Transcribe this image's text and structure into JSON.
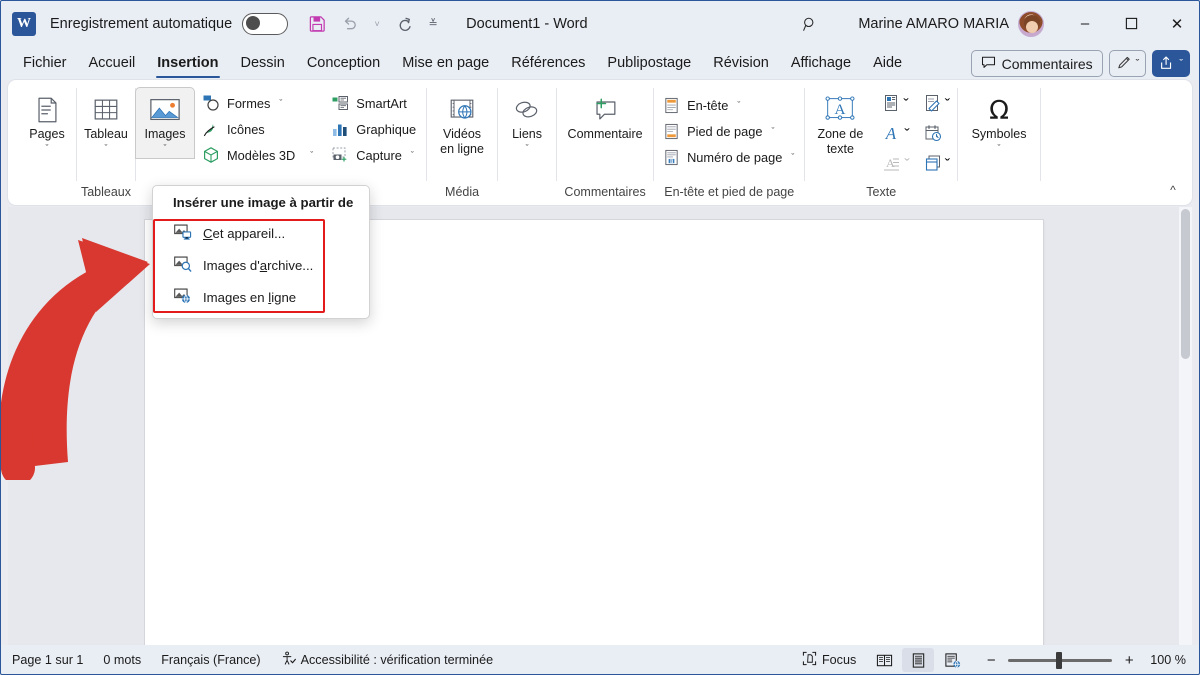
{
  "titlebar": {
    "app_logo": "word-logo",
    "autosave_label": "Enregistrement automatique",
    "autosave_state": "off",
    "save_icon": "save-icon",
    "undo_icon": "undo-icon",
    "redo_icon": "redo-icon",
    "customize_qat_icon": "customize-quick-access-toolbar-icon",
    "document_title": "Document1  -  Word",
    "search_icon": "search-icon",
    "user_name": "Marine AMARO MARIA",
    "minimize_label": "–",
    "maximize_label": "☐",
    "close_label": "✕"
  },
  "tabs": [
    {
      "label": "Fichier",
      "active": false
    },
    {
      "label": "Accueil",
      "active": false
    },
    {
      "label": "Insertion",
      "active": true
    },
    {
      "label": "Dessin",
      "active": false
    },
    {
      "label": "Conception",
      "active": false
    },
    {
      "label": "Mise en page",
      "active": false
    },
    {
      "label": "Références",
      "active": false
    },
    {
      "label": "Publipostage",
      "active": false
    },
    {
      "label": "Révision",
      "active": false
    },
    {
      "label": "Affichage",
      "active": false
    },
    {
      "label": "Aide",
      "active": false
    }
  ],
  "tabstrip_right": {
    "comments_label": "Commentaires",
    "comments_icon": "comment-icon",
    "pen_icon": "pen-icon",
    "share_icon": "share-icon",
    "chevron": "ˇ"
  },
  "ribbon": {
    "groups": [
      {
        "label": "",
        "big_buttons": [
          {
            "label": "Pages",
            "icon": "pages-icon",
            "chevron": "ˇ"
          }
        ]
      },
      {
        "label": "Tableaux",
        "big_buttons": [
          {
            "label": "Tableau",
            "icon": "table-icon",
            "chevron": "ˇ"
          }
        ]
      },
      {
        "label": "",
        "big_buttons": [
          {
            "label": "Images",
            "icon": "pictures-icon",
            "chevron": "ˇ",
            "active": true
          }
        ],
        "small_buttons": [
          {
            "label": "Formes",
            "icon": "shapes-icon",
            "chevron": "ˇ"
          },
          {
            "label": "Icônes",
            "icon": "icons-icon",
            "chevron": ""
          },
          {
            "label": "Modèles 3D",
            "icon": "3d-models-icon",
            "chevron": "ˇ"
          }
        ],
        "small_buttons2": [
          {
            "label": "SmartArt",
            "icon": "smartart-icon",
            "chevron": ""
          },
          {
            "label": "Graphique",
            "icon": "chart-icon",
            "chevron": ""
          },
          {
            "label": "Capture",
            "icon": "screenshot-icon",
            "chevron": "ˇ"
          }
        ]
      },
      {
        "label": "Média",
        "big_buttons": [
          {
            "label": "Vidéos\nen ligne",
            "icon": "online-videos-icon",
            "chevron": ""
          }
        ]
      },
      {
        "label": "",
        "big_buttons": [
          {
            "label": "Liens",
            "icon": "links-icon",
            "chevron": "ˇ"
          }
        ]
      },
      {
        "label": "Commentaires",
        "big_buttons": [
          {
            "label": "Commentaire",
            "icon": "new-comment-icon",
            "chevron": ""
          }
        ]
      },
      {
        "label": "En-tête et pied de page",
        "small_buttons": [
          {
            "label": "En-tête",
            "icon": "header-icon",
            "chevron": "ˇ"
          },
          {
            "label": "Pied de page",
            "icon": "footer-icon",
            "chevron": "ˇ"
          },
          {
            "label": "Numéro de page",
            "icon": "page-number-icon",
            "chevron": "ˇ"
          }
        ]
      },
      {
        "label": "Texte",
        "big_buttons": [
          {
            "label": "Zone de\ntexte",
            "icon": "text-box-icon",
            "chevron": "ˇ"
          }
        ],
        "icon_buttons": [
          {
            "icon": "quick-parts-icon",
            "chevron": "ˇ"
          },
          {
            "icon": "wordart-icon",
            "chevron": "ˇ"
          },
          {
            "icon": "drop-cap-icon",
            "chevron": "ˇ",
            "dim": true
          },
          {
            "icon": "signature-line-icon",
            "chevron": "ˇ"
          },
          {
            "icon": "date-time-icon",
            "chevron": ""
          },
          {
            "icon": "object-icon",
            "chevron": "ˇ"
          }
        ]
      },
      {
        "label": "",
        "big_buttons": [
          {
            "label": "Symboles",
            "icon": "symbols-icon",
            "chevron": "ˇ"
          }
        ]
      }
    ],
    "collapse_icon": "collapse-ribbon-icon"
  },
  "dropdown": {
    "header": "Insérer une image à partir de",
    "items": [
      {
        "label": "Cet appareil...",
        "accel": "C",
        "icon": "device-picture-icon"
      },
      {
        "label": "Images d'archive...",
        "accel": "a",
        "icon": "stock-images-icon"
      },
      {
        "label": "Images en ligne",
        "accel": "l",
        "icon": "online-pictures-icon"
      }
    ],
    "highlight_color": "#e31b1b"
  },
  "annotation": {
    "arrow_icon": "red-curved-arrow",
    "arrow_color": "#d8382f"
  },
  "statusbar": {
    "page_info": "Page 1 sur 1",
    "word_count": "0 mots",
    "language": "Français (France)",
    "accessibility_icon": "accessibility-icon",
    "accessibility": "Accessibilité : vérification terminée",
    "focus_icon": "focus-icon",
    "focus_label": "Focus",
    "view_read_icon": "read-mode-icon",
    "view_print_icon": "print-layout-icon",
    "view_web_icon": "web-layout-icon",
    "zoom_out": "−",
    "zoom_in": "+",
    "zoom_value": "100 %"
  },
  "colors": {
    "brand": "#2b579a",
    "titlebar_bg": "#e9edf4",
    "ribbon_bg": "#ffffff",
    "canvas_bg": "#e6e8ee",
    "page_bg": "#ffffff",
    "annotation_red": "#d8382f",
    "highlight_red": "#e31b1b"
  }
}
